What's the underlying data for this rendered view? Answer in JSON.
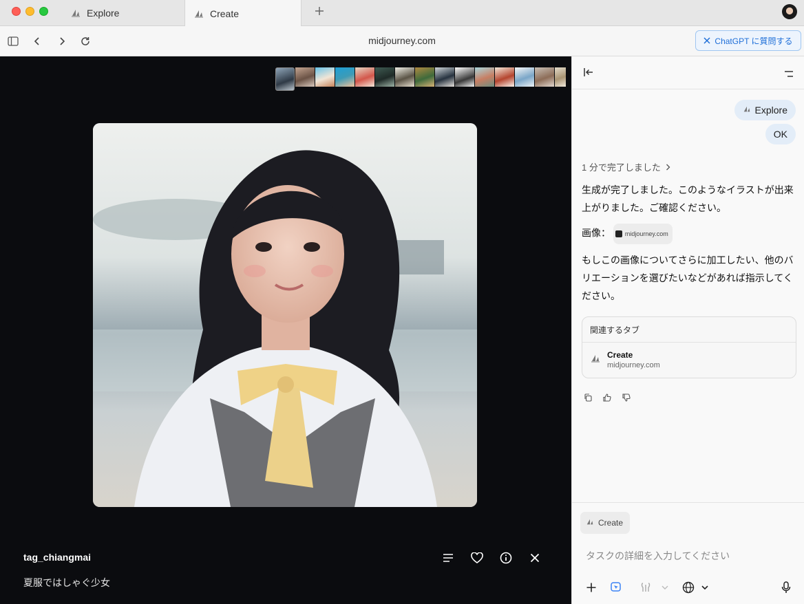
{
  "tabs": [
    {
      "label": "Explore",
      "active": false
    },
    {
      "label": "Create",
      "active": true
    }
  ],
  "toolbar": {
    "url": "midjourney.com",
    "ask_button_label": "ChatGPT に質問する"
  },
  "viewer": {
    "username": "tag_chiangmai",
    "caption": "夏服ではしゃぐ少女"
  },
  "sidebar": {
    "user_messages": [
      {
        "label": "Explore"
      },
      {
        "label": "OK"
      }
    ],
    "status": "1 分で完了しました",
    "reply": {
      "line1": "生成が完了しました。このようなイラストが出来上がりました。ご確認ください。",
      "image_label": "画像：",
      "image_chip": "midjourney.com",
      "line3": "もしこの画像についてさらに加工したい、他のバリエーションを選びたいなどがあれば指示してください。"
    },
    "related": {
      "heading": "関連するタブ",
      "item_title": "Create",
      "item_url": "midjourney.com"
    },
    "composer": {
      "context_chip": "Create",
      "placeholder": "タスクの詳細を入力してください"
    }
  },
  "colors": {
    "viewer_bg": "#0b0c0f",
    "accent": "#1f6fd8",
    "bubble": "#e3edf8"
  }
}
